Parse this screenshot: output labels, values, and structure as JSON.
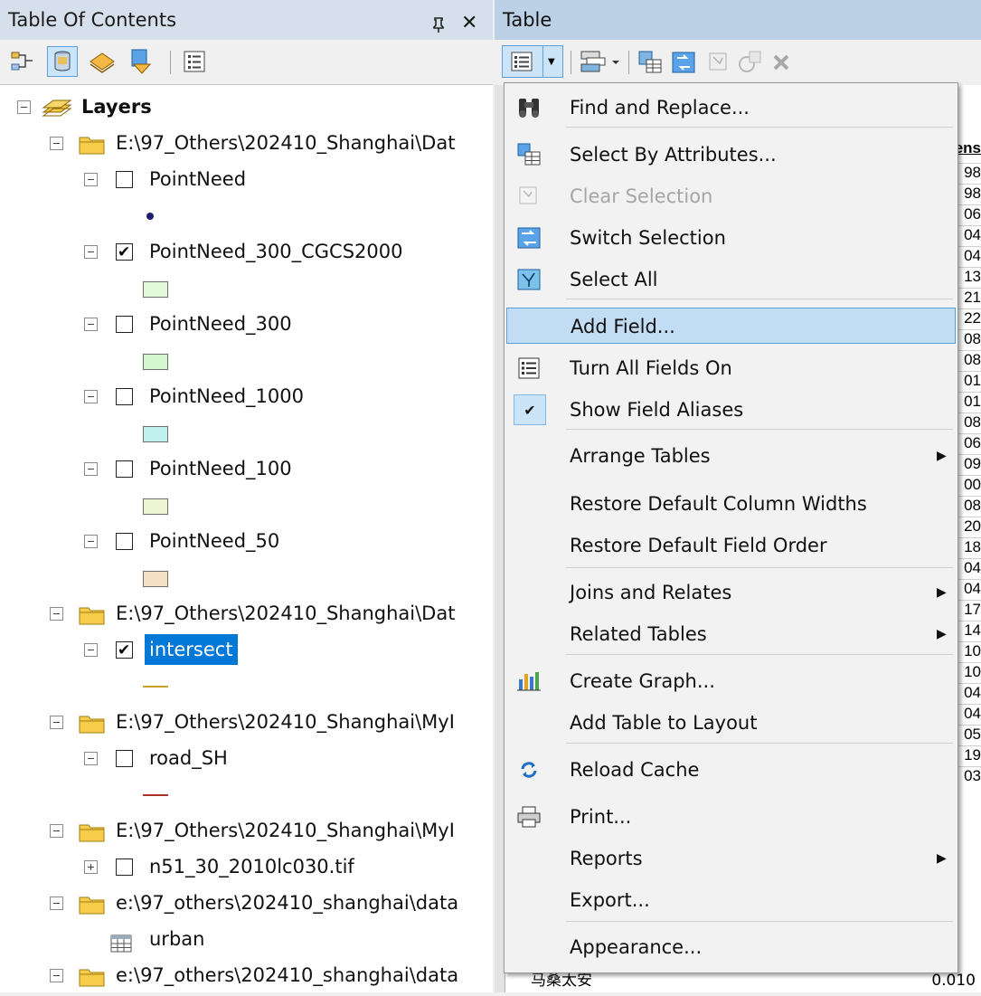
{
  "toc": {
    "title": "Table Of Contents",
    "pin": "ᵖ",
    "close": "✕",
    "root_label": "Layers",
    "groups": [
      {
        "path": "E:\\97_Others\\202410_Shanghai\\Dat"
      },
      {
        "path": "E:\\97_Others\\202410_Shanghai\\Dat"
      },
      {
        "path": "E:\\97_Others\\202410_Shanghai\\MyI"
      },
      {
        "path": "E:\\97_Others\\202410_Shanghai\\MyI"
      },
      {
        "path": "e:\\97_others\\202410_shanghai\\data"
      },
      {
        "path": "e:\\97_others\\202410_shanghai\\data"
      }
    ],
    "layers": [
      {
        "name": "PointNeed",
        "checked": false
      },
      {
        "name": "PointNeed_300_CGCS2000",
        "checked": true,
        "swatch": "#e3f7d9"
      },
      {
        "name": "PointNeed_300",
        "checked": false,
        "swatch": "#d4f7cf"
      },
      {
        "name": "PointNeed_1000",
        "checked": false,
        "swatch": "#bff0ee"
      },
      {
        "name": "PointNeed_100",
        "checked": false,
        "swatch": "#eef5d4"
      },
      {
        "name": "PointNeed_50",
        "checked": false,
        "swatch": "#f5e0c4"
      },
      {
        "name": "intersect",
        "checked": true
      },
      {
        "name": "road_SH",
        "checked": false
      },
      {
        "name": "n51_30_2010lc030.tif",
        "checked": false
      },
      {
        "name": "urban"
      }
    ]
  },
  "table": {
    "title": "Table",
    "grid_header": "ens",
    "grid_values": [
      "98",
      "98",
      "06",
      "04",
      "04",
      "13",
      "21",
      "22",
      "08",
      "08",
      "01",
      "01",
      "08",
      "06",
      "09",
      "00",
      "08",
      "20",
      "18",
      "04",
      "04",
      "17",
      "14",
      "10",
      "10",
      "04",
      "04",
      "05",
      "19",
      "03"
    ],
    "grid_footer_left": "马桑太安",
    "grid_footer_right": "0.010"
  },
  "menu": {
    "items": [
      {
        "label": "Find and Replace...",
        "icon": "binoculars-icon"
      },
      {
        "label": "Select By Attributes...",
        "icon": "select-by-attributes-icon"
      },
      {
        "label": "Clear Selection",
        "icon": "clear-selection-icon",
        "disabled": true
      },
      {
        "label": "Switch Selection",
        "icon": "switch-selection-icon"
      },
      {
        "label": "Select All",
        "icon": "select-all-icon"
      },
      {
        "label": "Add Field...",
        "highlighted": true
      },
      {
        "label": "Turn All Fields On",
        "icon": "fields-list-icon"
      },
      {
        "label": "Show Field Aliases",
        "icon": "checkmark-icon"
      },
      {
        "label": "Arrange Tables",
        "submenu": true
      },
      {
        "label": "Restore Default Column Widths"
      },
      {
        "label": "Restore Default Field Order"
      },
      {
        "label": "Joins and Relates",
        "submenu": true
      },
      {
        "label": "Related Tables",
        "submenu": true
      },
      {
        "label": "Create Graph...",
        "icon": "bar-chart-icon"
      },
      {
        "label": "Add Table to Layout"
      },
      {
        "label": "Reload Cache",
        "icon": "reload-icon"
      },
      {
        "label": "Print...",
        "icon": "printer-icon"
      },
      {
        "label": "Reports",
        "submenu": true
      },
      {
        "label": "Export..."
      },
      {
        "label": "Appearance..."
      }
    ],
    "submenu_arrow": "▶"
  }
}
